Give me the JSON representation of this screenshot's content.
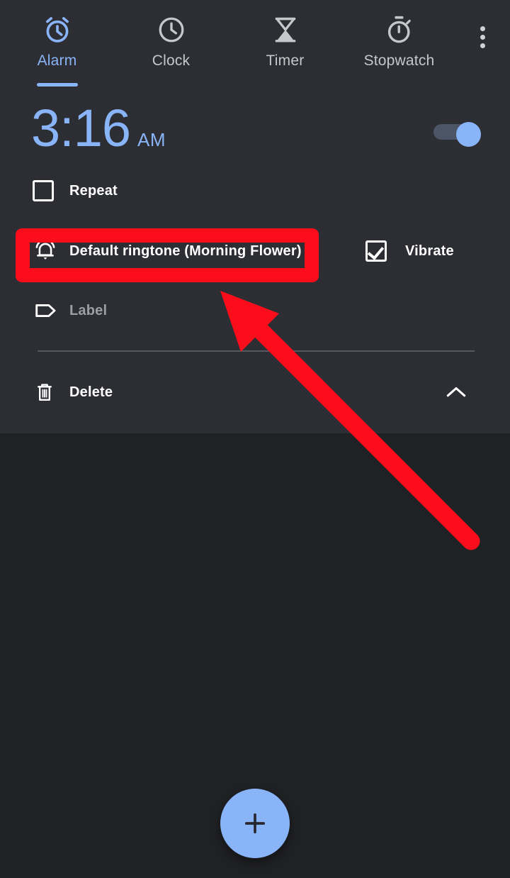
{
  "app": {
    "background_color": "#202124",
    "card_color": "#2c2e33",
    "accent_color": "#8ab4f8",
    "highlight_color": "#fc0d1b"
  },
  "tabs": [
    {
      "label": "Alarm",
      "icon": "alarm-clock-icon",
      "active": true
    },
    {
      "label": "Clock",
      "icon": "clock-icon",
      "active": false
    },
    {
      "label": "Timer",
      "icon": "hourglass-icon",
      "active": false
    },
    {
      "label": "Stopwatch",
      "icon": "stopwatch-icon",
      "active": false
    }
  ],
  "overflow_menu": {
    "icon": "more-vertical-icon"
  },
  "alarm": {
    "time": "3:16",
    "meridiem": "AM",
    "enabled": true,
    "rows": {
      "repeat": {
        "label": "Repeat",
        "checked": false,
        "icon": "checkbox-icon"
      },
      "ringtone": {
        "label": "Default ringtone (Morning Flower)",
        "icon": "bell-ring-icon"
      },
      "vibrate": {
        "label": "Vibrate",
        "checked": true,
        "icon": "checkbox-checked-icon"
      },
      "alarm_label": {
        "label": "Label",
        "icon": "tag-icon",
        "placeholder": "Label"
      },
      "delete": {
        "label": "Delete",
        "icon": "trash-icon"
      }
    },
    "collapse": {
      "icon": "chevron-up-icon"
    }
  },
  "fab": {
    "label": "+",
    "icon": "plus-icon"
  }
}
